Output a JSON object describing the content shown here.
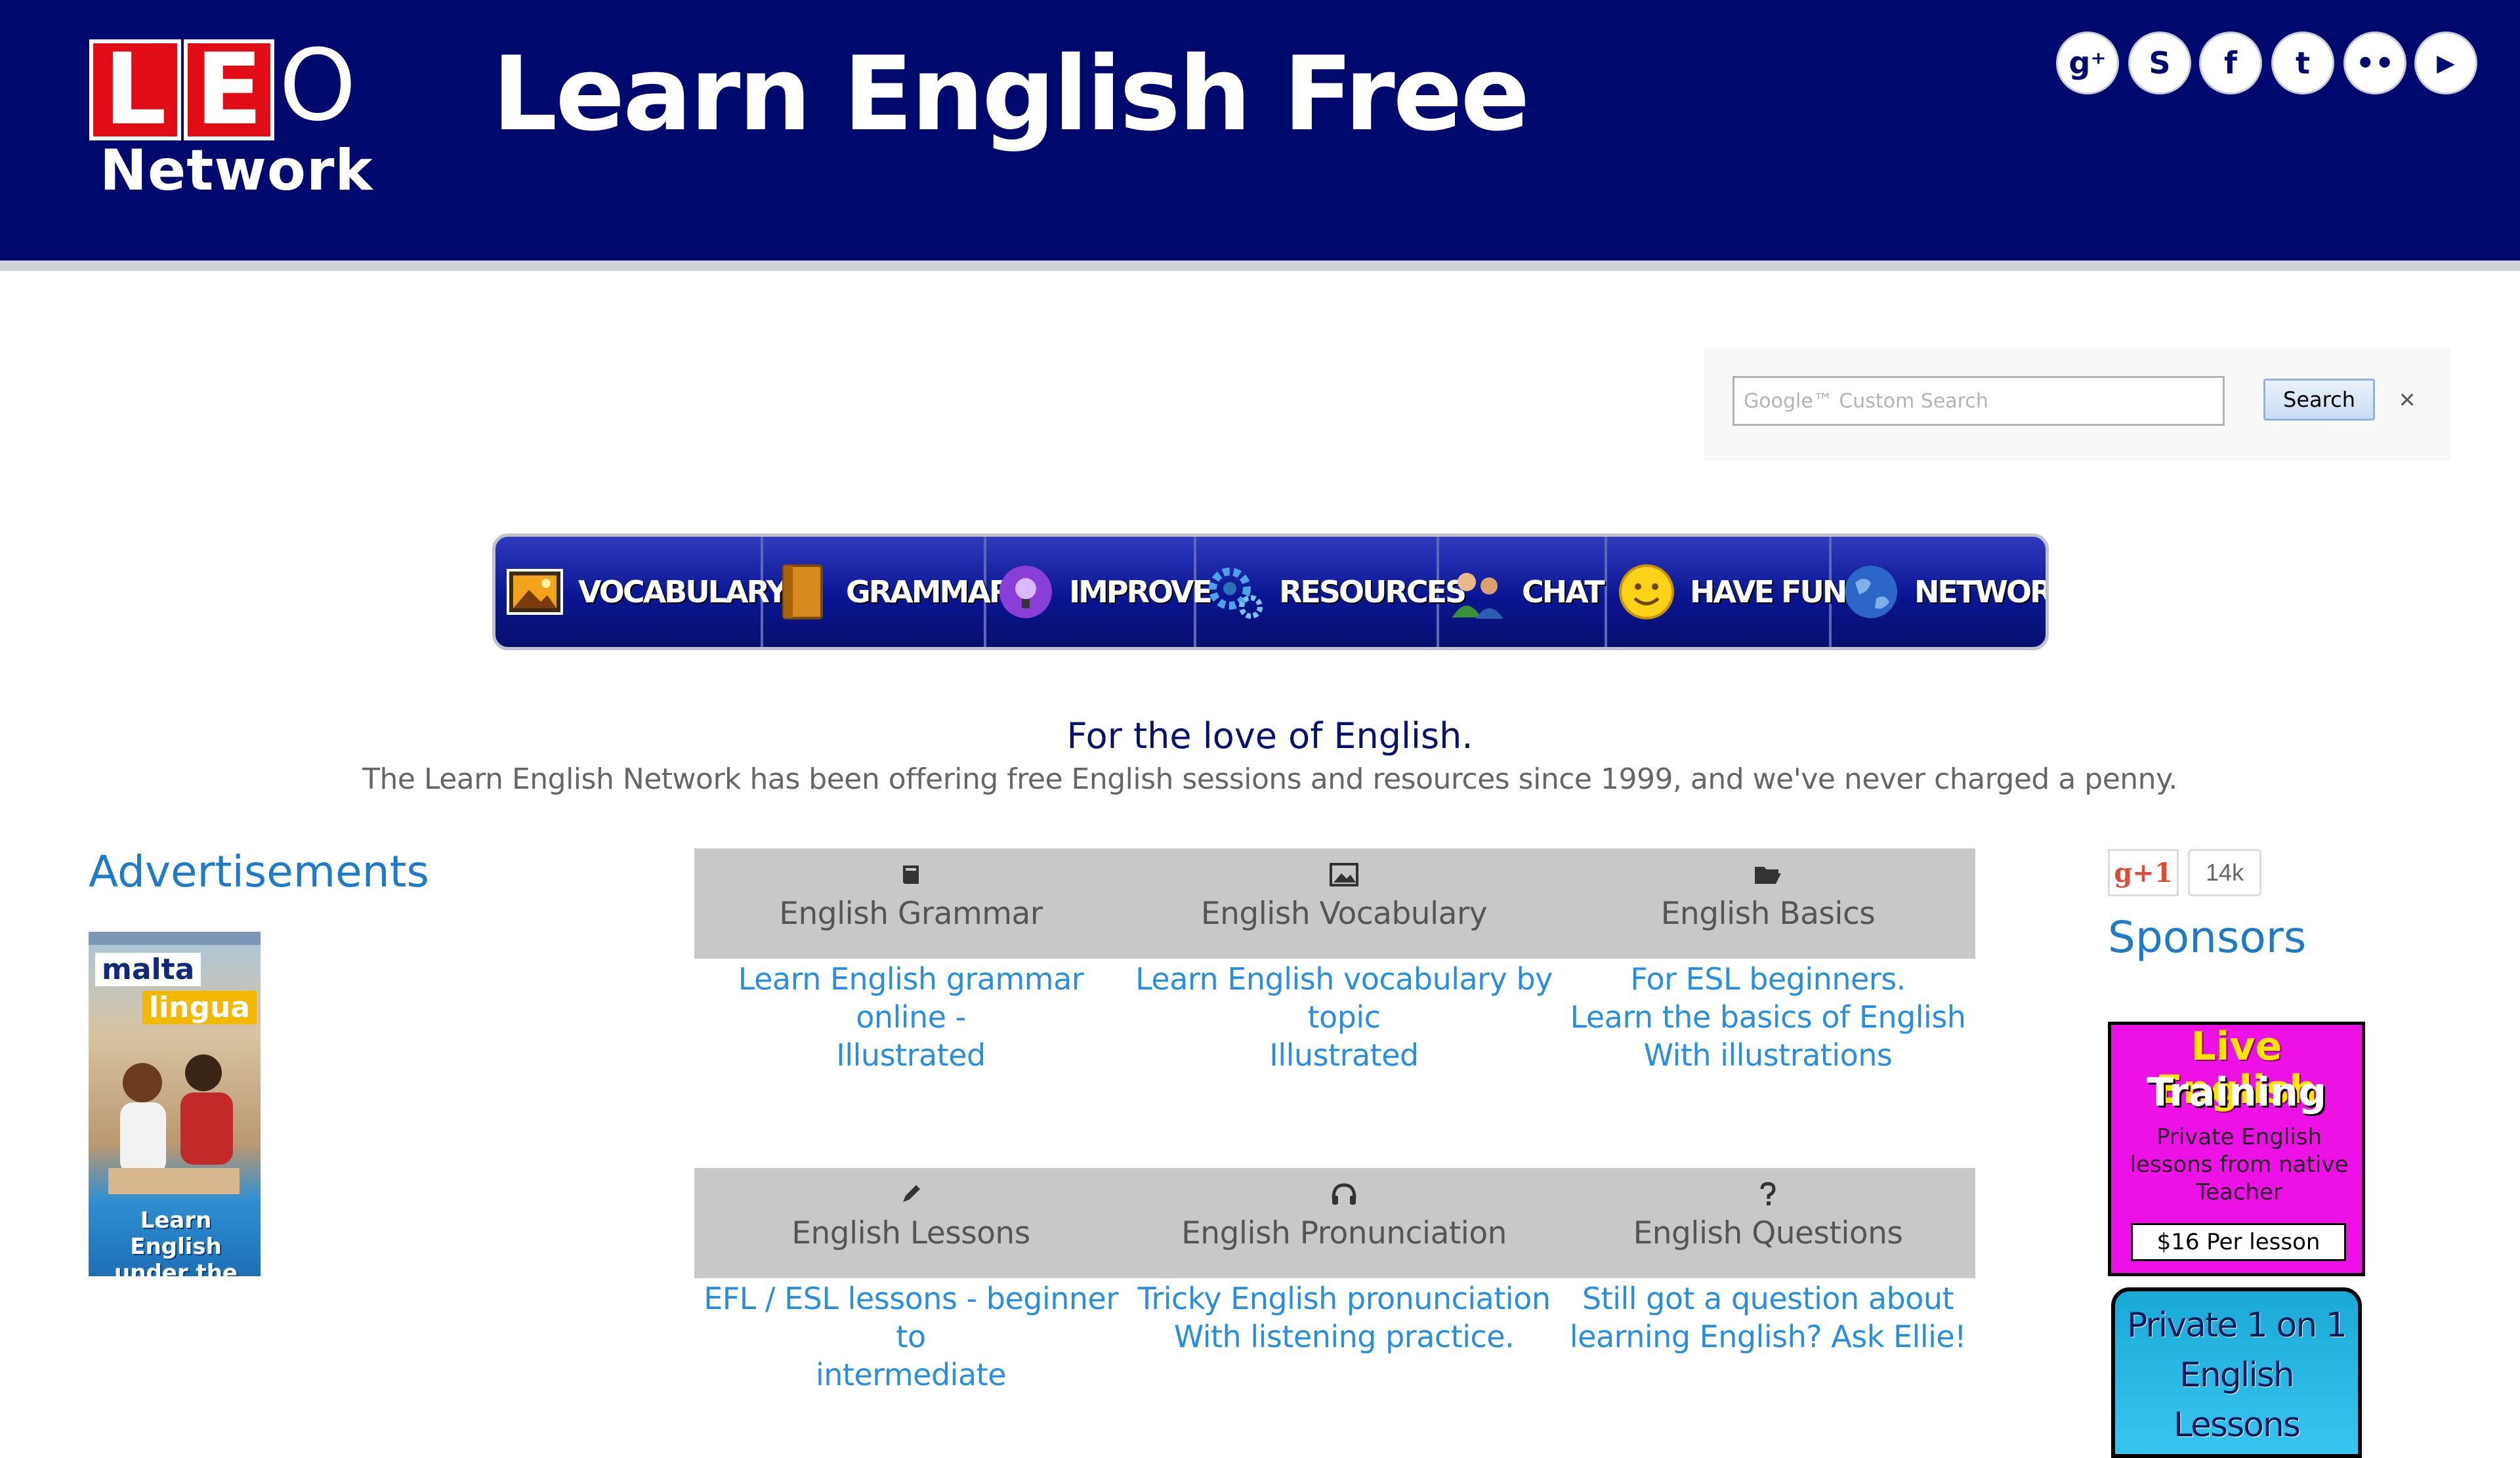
{
  "header": {
    "logo": {
      "letters": [
        "L",
        "E",
        "O"
      ],
      "network": "Network"
    },
    "title": "Learn English Free",
    "social": [
      {
        "icon": "google-plus-icon",
        "glyph": "g⁺"
      },
      {
        "icon": "skype-icon",
        "glyph": "S"
      },
      {
        "icon": "facebook-icon",
        "glyph": "f"
      },
      {
        "icon": "twitter-icon",
        "glyph": "t"
      },
      {
        "icon": "flickr-icon",
        "glyph": "••"
      },
      {
        "icon": "youtube-icon",
        "glyph": "▶"
      }
    ]
  },
  "search": {
    "placeholder": "Google™ Custom Search",
    "button": "Search",
    "clear": "×"
  },
  "nav": {
    "items": [
      {
        "label": "VOCABULARY",
        "icon": "picture-icon"
      },
      {
        "label": "GRAMMAR",
        "icon": "book-icon"
      },
      {
        "label": "IMPROVE",
        "icon": "lightbulb-icon"
      },
      {
        "label": "RESOURCES",
        "icon": "gears-icon"
      },
      {
        "label": "CHAT",
        "icon": "people-icon"
      },
      {
        "label": "HAVE FUN",
        "icon": "smiley-icon"
      },
      {
        "label": "NETWORK",
        "icon": "globe-icon"
      }
    ]
  },
  "intro": {
    "tagline": "For the love of English.",
    "text": "The Learn English Network has been offering free English sessions and resources since 1999, and we've never charged a penny."
  },
  "left": {
    "ads_heading": "Advertisements",
    "malta_ad": {
      "brand1": "malta",
      "brand2": "lingua",
      "tagline": "Learn English under the sun!"
    }
  },
  "categories": [
    {
      "title": "English Grammar",
      "icon": "book-icon",
      "desc": [
        "Learn English grammar online -",
        "Illustrated"
      ]
    },
    {
      "title": "English Vocabulary",
      "icon": "picture-icon",
      "desc": [
        "Learn English vocabulary by",
        "topic",
        "Illustrated"
      ]
    },
    {
      "title": "English Basics",
      "icon": "folder-open-icon",
      "desc": [
        "For ESL beginners.",
        "Learn the basics of English",
        "With illustrations"
      ]
    },
    {
      "title": "English Lessons",
      "icon": "pencil-icon",
      "desc": [
        "EFL / ESL lessons - beginner to",
        "intermediate"
      ]
    },
    {
      "title": "English Pronunciation",
      "icon": "headphones-icon",
      "desc": [
        "Tricky English pronunciation",
        "With listening practice."
      ]
    },
    {
      "title": "English Questions",
      "icon": "question-icon",
      "desc": [
        "Still got a question about",
        "learning English? Ask Ellie!"
      ]
    }
  ],
  "right": {
    "gplus": {
      "label": "g+1",
      "count": "14k"
    },
    "sponsors_heading": "Sponsors",
    "live_ad": {
      "title1": "Live English",
      "title2": "Training",
      "sub": "Private English lessons from native Teacher",
      "price": "$16 Per lesson"
    },
    "private_ad": {
      "line1": "Private 1 on 1",
      "line2": "English Lessons"
    }
  }
}
